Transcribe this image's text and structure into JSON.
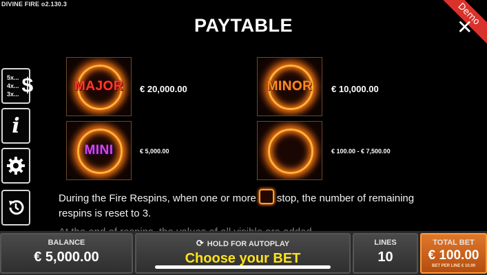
{
  "header": {
    "version": "DIVINE FIRE  o2.130.3",
    "title": "PAYTABLE",
    "demo_label": "Demo",
    "close_glyph": "✕"
  },
  "side_nav": {
    "paytable_lines": [
      "5x...",
      "4x...",
      "3x..."
    ],
    "paytable_symbol": "$",
    "info_glyph": "i",
    "settings_glyph": "⚙",
    "history_glyph": "↺"
  },
  "symbols": [
    {
      "name": "MAJOR",
      "prize": "€ 20,000.00"
    },
    {
      "name": "MINOR",
      "prize": "€ 10,000.00"
    },
    {
      "name": "MINI",
      "prize": "€ 5,000.00"
    },
    {
      "name": "",
      "prize": "€ 100.00 - € 7,500.00"
    }
  ],
  "description": {
    "before_icon": "During the Fire Respins, when one or more",
    "after_icon": "stop, the number of remaining respins is reset to 3.",
    "cut_off": "At the end of respins, the values of all visible      are added."
  },
  "bottom_bar": {
    "balance_label": "BALANCE",
    "balance_value": "€ 5,000.00",
    "autoplay_label": "HOLD FOR AUTOPLAY",
    "autoplay_icon": "⟳",
    "choose_bet": "Choose your BET",
    "lines_label": "LINES",
    "lines_value": "10",
    "total_bet_label": "TOTAL BET",
    "total_bet_value": "€ 100.00",
    "bet_per_line": "BET PER LINE € 10.00"
  },
  "colors": {
    "accent_orange": "#e0782a",
    "choose_bet_yellow": "#ffe21a",
    "demo_red": "#d9322a"
  }
}
